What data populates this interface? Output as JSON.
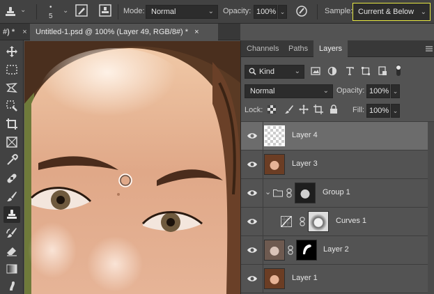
{
  "options_bar": {
    "brush_size": "5",
    "mode_label": "Mode:",
    "mode_value": "Normal",
    "opacity_label": "Opacity:",
    "opacity_value": "100%",
    "sample_label": "Sample:",
    "sample_value": "Current & Below",
    "highlight_color": "#e8e842"
  },
  "tabs": {
    "left_fragment": "#) *",
    "left_close": "×",
    "document_title": "Untitled-1.psd @ 100% (Layer 49, RGB/8#) *",
    "document_close": "×"
  },
  "tools": [
    "move-icon",
    "marquee-icon",
    "lasso-icon",
    "quick-select-icon",
    "crop-icon",
    "frame-icon",
    "eyedropper-icon",
    "healing-brush-icon",
    "brush-icon",
    "clone-stamp-icon",
    "history-brush-icon",
    "eraser-icon",
    "gradient-icon",
    "smudge-icon"
  ],
  "panel": {
    "tabs": [
      "Channels",
      "Paths",
      "Layers"
    ],
    "active_tab": "Layers",
    "filter_value": "Kind",
    "blend_value": "Normal",
    "opacity_label": "Opacity:",
    "opacity_value": "100%",
    "lock_label": "Lock:",
    "fill_label": "Fill:",
    "fill_value": "100%"
  },
  "layers": [
    {
      "name": "Layer 4",
      "selected": true
    },
    {
      "name": "Layer 3",
      "selected": false
    },
    {
      "name": "Group 1",
      "selected": false
    },
    {
      "name": "Curves 1",
      "selected": false
    },
    {
      "name": "Layer 2",
      "selected": false
    },
    {
      "name": "Layer 1",
      "selected": false
    }
  ]
}
